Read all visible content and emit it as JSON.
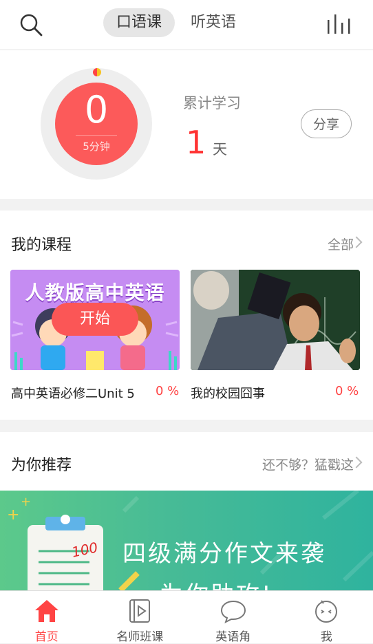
{
  "topbar": {
    "search_icon": "search-icon",
    "tabs": [
      {
        "label": "口语课",
        "active": true
      },
      {
        "label": "听英语",
        "active": false
      }
    ],
    "stats_icon": "bar-chart-icon"
  },
  "progress": {
    "minutes_value": "0",
    "goal_label": "5分钟",
    "cumulative_label": "累计学习",
    "days_value": "1",
    "days_unit": "天",
    "share_label": "分享",
    "accent_color": "#fc5a5a"
  },
  "my_courses": {
    "title": "我的课程",
    "more_label": "全部",
    "courses": [
      {
        "name": "高中英语必修二Unit 5",
        "percent": "0 %",
        "thumb_title": "人教版高中英语",
        "start_label": "开始"
      },
      {
        "name": "我的校园囧事",
        "percent": "0 %"
      }
    ]
  },
  "recommend": {
    "title": "为你推荐",
    "more_label": "还不够？猛戳这",
    "banner_line1": "四级满分作文来袭",
    "banner_line2": "为你助攻!",
    "banner_badge": "100"
  },
  "tabbar": {
    "items": [
      {
        "label": "首页",
        "icon": "home-icon",
        "active": true
      },
      {
        "label": "名师班课",
        "icon": "video-play-icon",
        "active": false
      },
      {
        "label": "英语角",
        "icon": "chat-bubble-icon",
        "active": false
      },
      {
        "label": "我",
        "icon": "profile-face-icon",
        "active": false
      }
    ]
  }
}
